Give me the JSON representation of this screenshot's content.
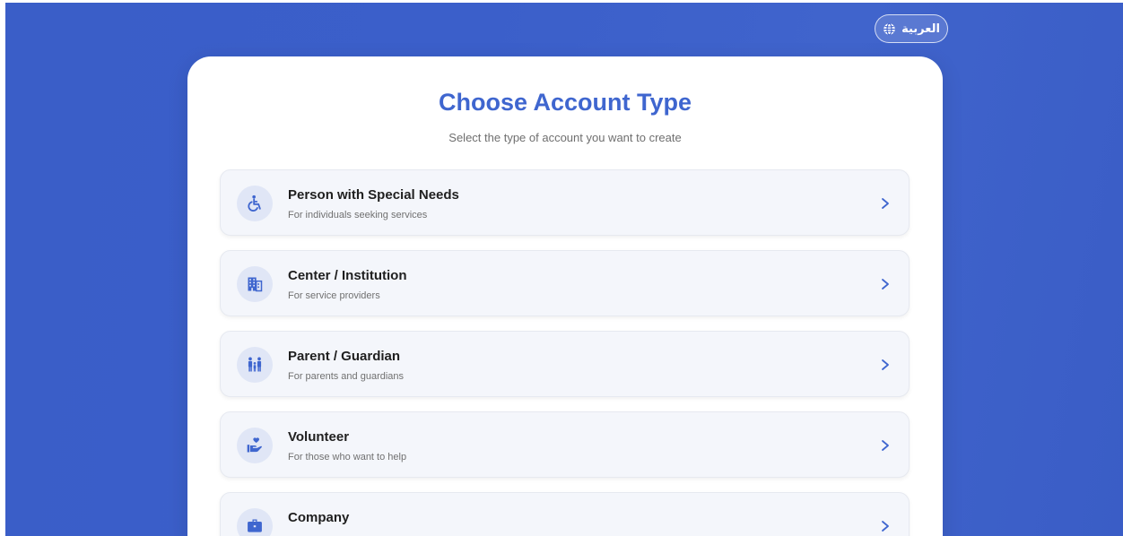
{
  "header": {
    "language_label": "العربية",
    "icon": "globe-icon"
  },
  "card": {
    "title": "Choose Account Type",
    "subtitle": "Select the type of account you want to create"
  },
  "options": [
    {
      "label": "Person with Special Needs",
      "description": "For individuals seeking services",
      "icon": "accessibility-icon"
    },
    {
      "label": "Center / Institution",
      "description": "For service providers",
      "icon": "building-icon"
    },
    {
      "label": "Parent / Guardian",
      "description": "For parents and guardians",
      "icon": "family-icon"
    },
    {
      "label": "Volunteer",
      "description": "For those who want to help",
      "icon": "helping-hand-icon"
    },
    {
      "label": "Company",
      "description": "",
      "icon": "briefcase-icon"
    }
  ],
  "colors": {
    "background": "#3b5fca",
    "accent": "#3f66cf",
    "card": "#ffffff",
    "option_bg": "#f4f6fb"
  }
}
